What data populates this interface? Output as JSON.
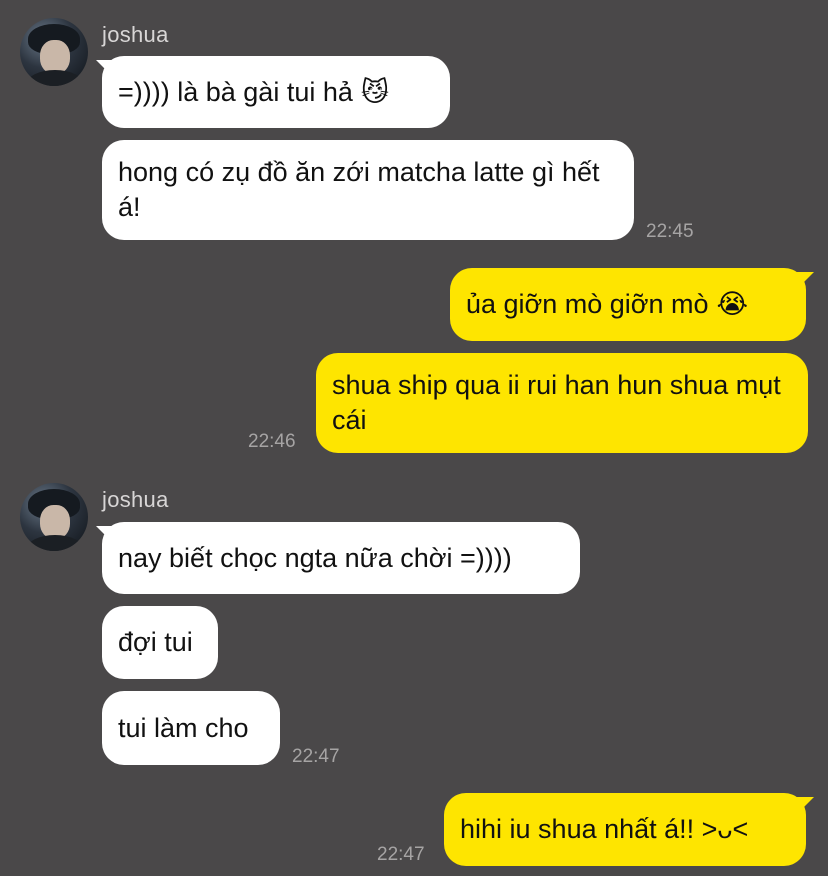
{
  "chat": {
    "sender_name": "joshua",
    "groups": [
      {
        "messages": [
          {
            "text": "=)))) là bà gài tui hả",
            "emoji": "😼"
          },
          {
            "text": "hong có zụ đồ ăn zới matcha latte gì hết á!",
            "emoji": ""
          }
        ],
        "time": "22:45"
      },
      {
        "messages": [
          {
            "text": "ủa giỡn mò giỡn mò",
            "emoji": "😭"
          },
          {
            "text": "shua ship qua ii rui han hun shua mụt cái",
            "emoji": "🫣"
          }
        ],
        "time": "22:46"
      },
      {
        "messages": [
          {
            "text": "nay biết chọc ngta nữa chời =))))",
            "emoji": ""
          },
          {
            "text": "đợi tui",
            "emoji": ""
          },
          {
            "text": "tui làm cho",
            "emoji": ""
          }
        ],
        "time": "22:47"
      },
      {
        "messages": [
          {
            "text": "hihi iu shua nhất á!! >ᴗ<",
            "emoji": ""
          }
        ],
        "time": "22:47"
      }
    ]
  },
  "colors": {
    "background": "#4a4849",
    "incoming_bubble": "#ffffff",
    "outgoing_bubble": "#fee500",
    "timestamp": "#a6a4a4",
    "sender_name": "#d8d6d6"
  },
  "icons": {
    "avatar": "profile-photo"
  }
}
